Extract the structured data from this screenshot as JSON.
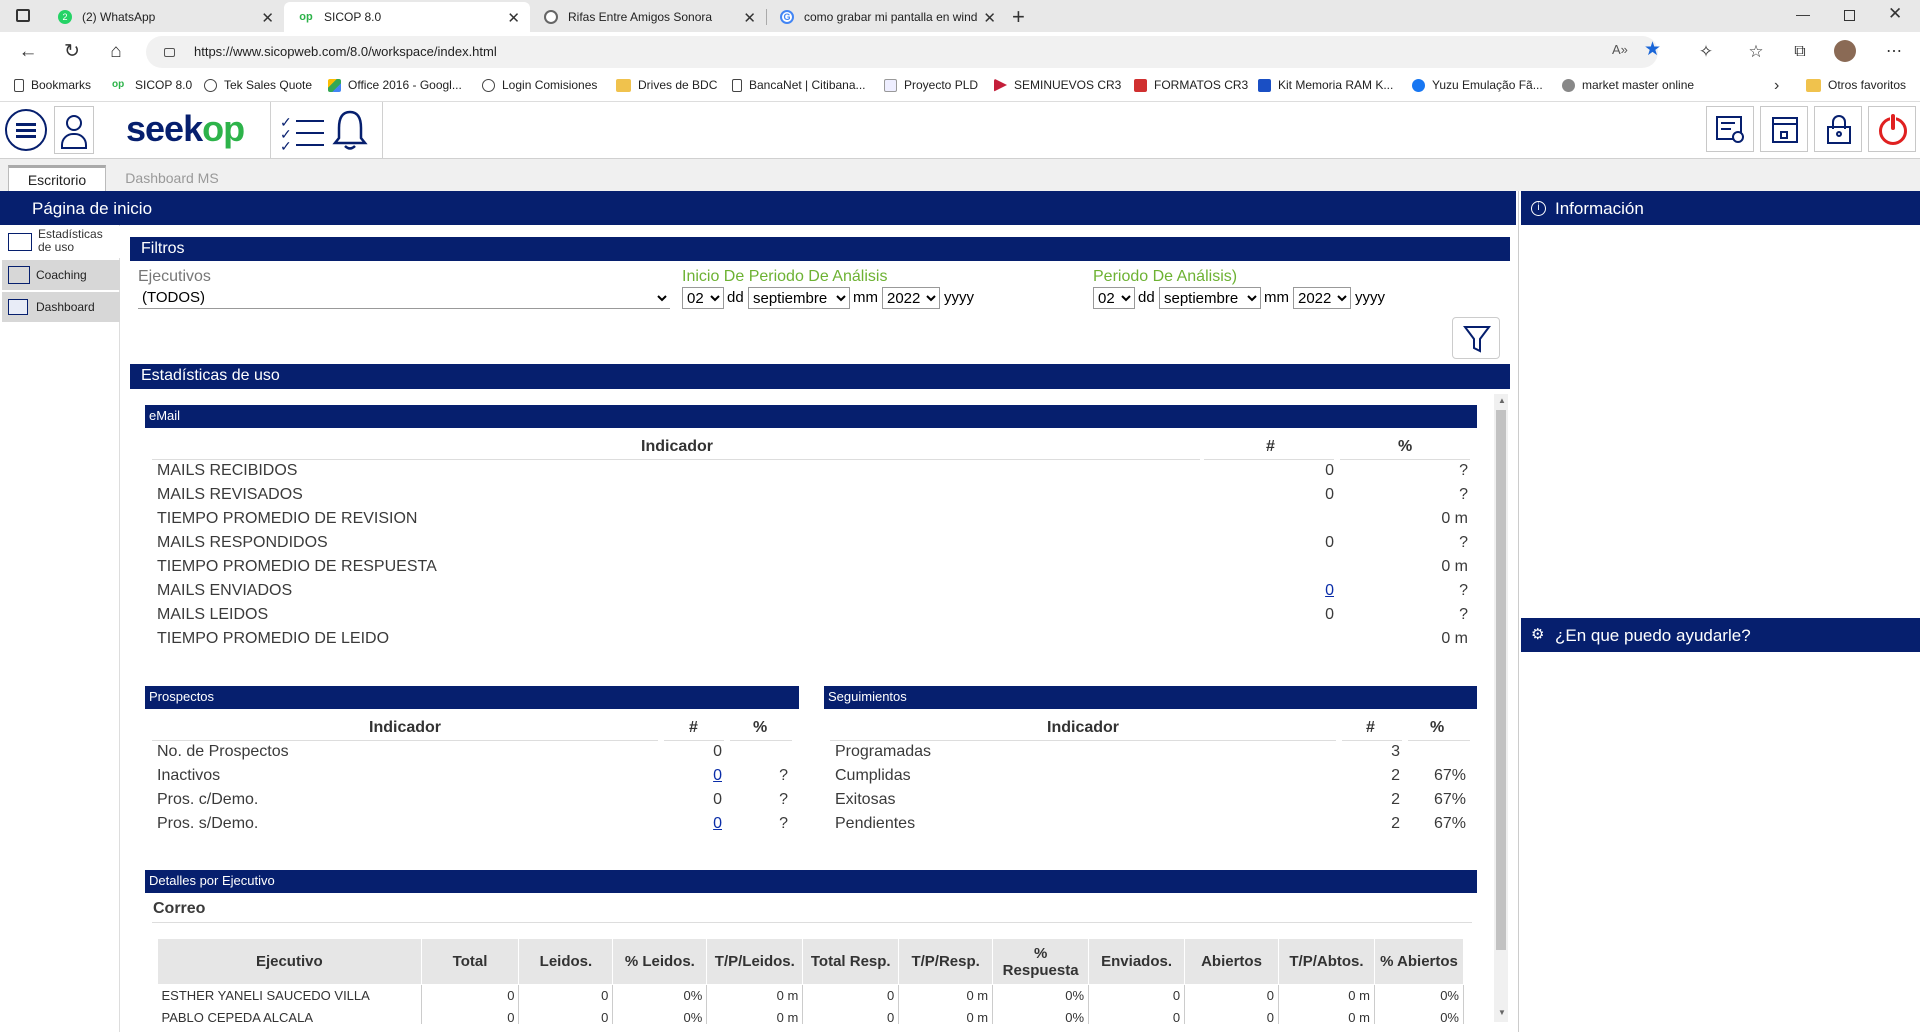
{
  "browser": {
    "tabs": [
      {
        "title": "(2) WhatsApp",
        "active": false,
        "icon": "whatsapp-icon",
        "color": "#25d366"
      },
      {
        "title": "SICOP 8.0",
        "active": true,
        "icon": "seekop-icon",
        "color": "#2db34a"
      },
      {
        "title": "Rifas Entre Amigos Sonora",
        "active": false,
        "icon": "globe-icon",
        "color": "#666666"
      },
      {
        "title": "como grabar mi pantalla en wind",
        "active": false,
        "icon": "google-icon",
        "color": "#4285f4"
      }
    ],
    "url": "https://www.sicopweb.com/8.0/workspace/index.html",
    "bookmarks": [
      "Bookmarks",
      "SICOP 8.0",
      "Tek Sales Quote",
      "Office 2016 - Googl...",
      "Login Comisiones",
      "Drives de BDC",
      "BancaNet | Citibana...",
      "Proyecto PLD",
      "SEMINUEVOS CR3",
      "FORMATOS CR3",
      "Kit Memoria RAM K...",
      "Yuzu Emulação Fã...",
      "market master online"
    ],
    "other_favorites": "Otros favoritos"
  },
  "app": {
    "logo": "seekop",
    "tabs": [
      "Escritorio",
      "Dashboard MS"
    ],
    "page_title": "Página de inicio",
    "sidebar": [
      "Estadísticas de uso",
      "Coaching",
      "Dashboard"
    ],
    "info_title": "Información",
    "help_title": "¿En que puedo ayudarle?"
  },
  "filters": {
    "title": "Filtros",
    "ejecutivos_label": "Ejecutivos",
    "ejecutivos_value": "(TODOS)",
    "inicio_label": "Inicio De Periodo De Análisis",
    "periodo_label": "Periodo De Análisis)",
    "inicio": {
      "day": "02",
      "month": "septiembre",
      "year": "2022"
    },
    "periodo": {
      "day": "02",
      "month": "septiembre",
      "year": "2022"
    },
    "dd": "dd",
    "mm": "mm",
    "yyyy": "yyyy"
  },
  "stats": {
    "title": "Estadísticas de uso",
    "email": {
      "title": "eMail",
      "headers": [
        "Indicador",
        "#",
        "%"
      ],
      "rows": [
        {
          "label": "MAILS RECIBIDOS",
          "num": "0",
          "pct": "?"
        },
        {
          "label": "MAILS REVISADOS",
          "num": "0",
          "pct": "?"
        },
        {
          "label": "TIEMPO PROMEDIO DE REVISION",
          "num": "",
          "pct": "0 m"
        },
        {
          "label": "MAILS RESPONDIDOS",
          "num": "0",
          "pct": "?"
        },
        {
          "label": "TIEMPO PROMEDIO DE RESPUESTA",
          "num": "",
          "pct": "0 m"
        },
        {
          "label": "MAILS ENVIADOS",
          "num": "0",
          "pct": "?"
        },
        {
          "label": "MAILS LEIDOS",
          "num": "0",
          "pct": "?"
        },
        {
          "label": "TIEMPO PROMEDIO DE LEIDO",
          "num": "",
          "pct": "0 m"
        }
      ]
    },
    "prospectos": {
      "title": "Prospectos",
      "headers": [
        "Indicador",
        "#",
        "%"
      ],
      "rows": [
        {
          "label": "No. de Prospectos",
          "num": "0",
          "pct": ""
        },
        {
          "label": "Inactivos",
          "num": "0",
          "pct": "?"
        },
        {
          "label": "Pros. c/Demo.",
          "num": "0",
          "pct": "?"
        },
        {
          "label": "Pros. s/Demo.",
          "num": "0",
          "pct": "?"
        }
      ]
    },
    "seguimientos": {
      "title": "Seguimientos",
      "headers": [
        "Indicador",
        "#",
        "%"
      ],
      "rows": [
        {
          "label": "Programadas",
          "num": "3",
          "pct": ""
        },
        {
          "label": "Cumplidas",
          "num": "2",
          "pct": "67%"
        },
        {
          "label": "Exitosas",
          "num": "2",
          "pct": "67%"
        },
        {
          "label": "Pendientes",
          "num": "2",
          "pct": "67%"
        }
      ]
    },
    "detalles": {
      "title": "Detalles por Ejecutivo",
      "subtitle": "Correo",
      "headers": [
        "Ejecutivo",
        "Total",
        "Leidos.",
        "% Leidos.",
        "T/P/Leidos.",
        "Total Resp.",
        "T/P/Resp.",
        "% Respuesta",
        "Enviados.",
        "Abiertos",
        "T/P/Abtos.",
        "% Abiertos"
      ],
      "rows": [
        [
          "ESTHER YANELI SAUCEDO VILLA",
          "0",
          "0",
          "0%",
          "0 m",
          "0",
          "0 m",
          "0%",
          "0",
          "0",
          "0 m",
          "0%"
        ],
        [
          "PABLO CEPEDA ALCALA",
          "0",
          "0",
          "0%",
          "0 m",
          "0",
          "0 m",
          "0%",
          "0",
          "0",
          "0 m",
          "0%"
        ]
      ]
    }
  }
}
